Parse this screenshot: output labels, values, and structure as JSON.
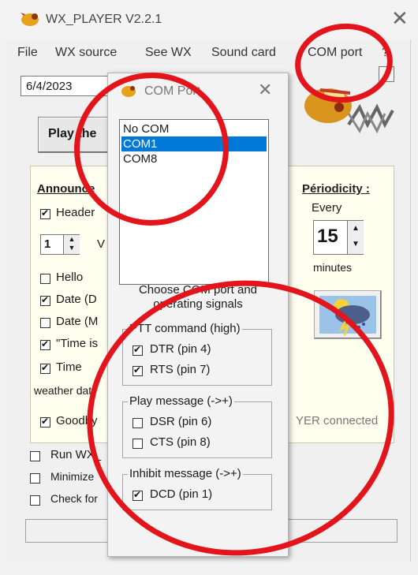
{
  "window": {
    "title": "WX_PLAYER V2.2.1",
    "menu": [
      "File",
      "WX source",
      "See WX",
      "Sound card",
      "COM port",
      "?"
    ]
  },
  "main": {
    "date": "6/4/2023",
    "play_button": "Play the",
    "announce_title": "Announce",
    "checkboxes": [
      {
        "label": "Header",
        "checked": true
      },
      {
        "label": "Hello",
        "checked": false
      },
      {
        "label": "Date (D",
        "checked": true
      },
      {
        "label": "Date (M",
        "checked": false
      },
      {
        "label": "\"Time is",
        "checked": true
      },
      {
        "label": "Time",
        "checked": true
      },
      {
        "label": "Goodby",
        "checked": true
      }
    ],
    "spinner_value": "1",
    "spinner_suffix": "V",
    "weather_label": "weather dat",
    "periodicity_title": "Périodicity :",
    "every_label": "Every",
    "period_value": "15",
    "minutes_label": "minutes",
    "status_text": "YER connected",
    "options": [
      {
        "label": "Run WX_",
        "checked": false
      },
      {
        "label": "Minimize",
        "checked": false
      },
      {
        "label": "Check for",
        "checked": false
      }
    ]
  },
  "dialog": {
    "title": "COM Port",
    "list": [
      "No COM",
      "COM1",
      "COM8"
    ],
    "selected_index": 1,
    "instructions_line1": "Choose COM port and",
    "instructions_line2": "operating signals",
    "groups": [
      {
        "title": "PTT command (high)",
        "items": [
          {
            "label": "DTR (pin 4)",
            "checked": true
          },
          {
            "label": "RTS (pin 7)",
            "checked": true
          }
        ]
      },
      {
        "title": "Play message (->+)",
        "items": [
          {
            "label": "DSR (pin 6)",
            "checked": false
          },
          {
            "label": "CTS (pin 8)",
            "checked": false
          }
        ]
      },
      {
        "title": "Inhibit message (->+)",
        "items": [
          {
            "label": "DCD (pin 1)",
            "checked": true
          }
        ]
      }
    ]
  },
  "colors": {
    "annotation_red": "#e3141b",
    "selection_blue": "#0078d7",
    "panel_bg": "#fffff0"
  }
}
